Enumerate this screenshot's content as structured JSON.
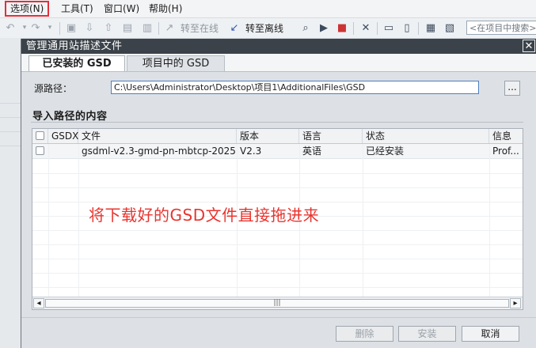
{
  "menubar": {
    "items": [
      {
        "label": "选项(N)"
      },
      {
        "label": "工具(T)"
      },
      {
        "label": "窗口(W)"
      },
      {
        "label": "帮助(H)"
      }
    ]
  },
  "toolbar": {
    "go_online_label": "转至在线",
    "go_offline_label": "转至离线",
    "search_placeholder": "<在项目中搜索>",
    "icons": [
      "undo-icon",
      "redo-icon",
      "save-icon",
      "download-icon",
      "upload-icon",
      "compile-icon",
      "go-online-icon",
      "go-offline-icon",
      "accessible-devices-icon",
      "start-cpu-icon",
      "stop-cpu-icon",
      "cross-reference-icon",
      "split-horizontal-icon",
      "split-vertical-icon",
      "save-layout-icon",
      "close-layout-icon"
    ]
  },
  "dialog": {
    "title": "管理通用站描述文件",
    "close_glyph": "✕",
    "tabs": [
      {
        "label": "已安装的 GSD",
        "active": true
      },
      {
        "label": "项目中的 GSD",
        "active": false
      }
    ],
    "source_path_label": "源路径：",
    "source_path_value": "C:\\Users\\Administrator\\Desktop\\项目1\\AdditionalFiles\\GSD",
    "browse_label": "...",
    "section_title": "导入路径的内容",
    "table": {
      "columns": [
        "GSDX",
        "文件",
        "版本",
        "语言",
        "状态",
        "信息"
      ],
      "rows": [
        {
          "gsdx": "",
          "file": "gsdml-v2.3-gmd-pn-mbtcp-2025...",
          "version": "V2.3",
          "language": "英语",
          "status": "已经安装",
          "info": "Prof..."
        }
      ]
    },
    "annotation": "将下载好的GSD文件直接拖进来",
    "buttons": {
      "delete_label": "删除",
      "install_label": "安装",
      "cancel_label": "取消"
    }
  },
  "colors": {
    "highlight_box": "#e0303b",
    "annotation_text": "#e8352f",
    "dialog_title_bg": "#3b4249"
  }
}
